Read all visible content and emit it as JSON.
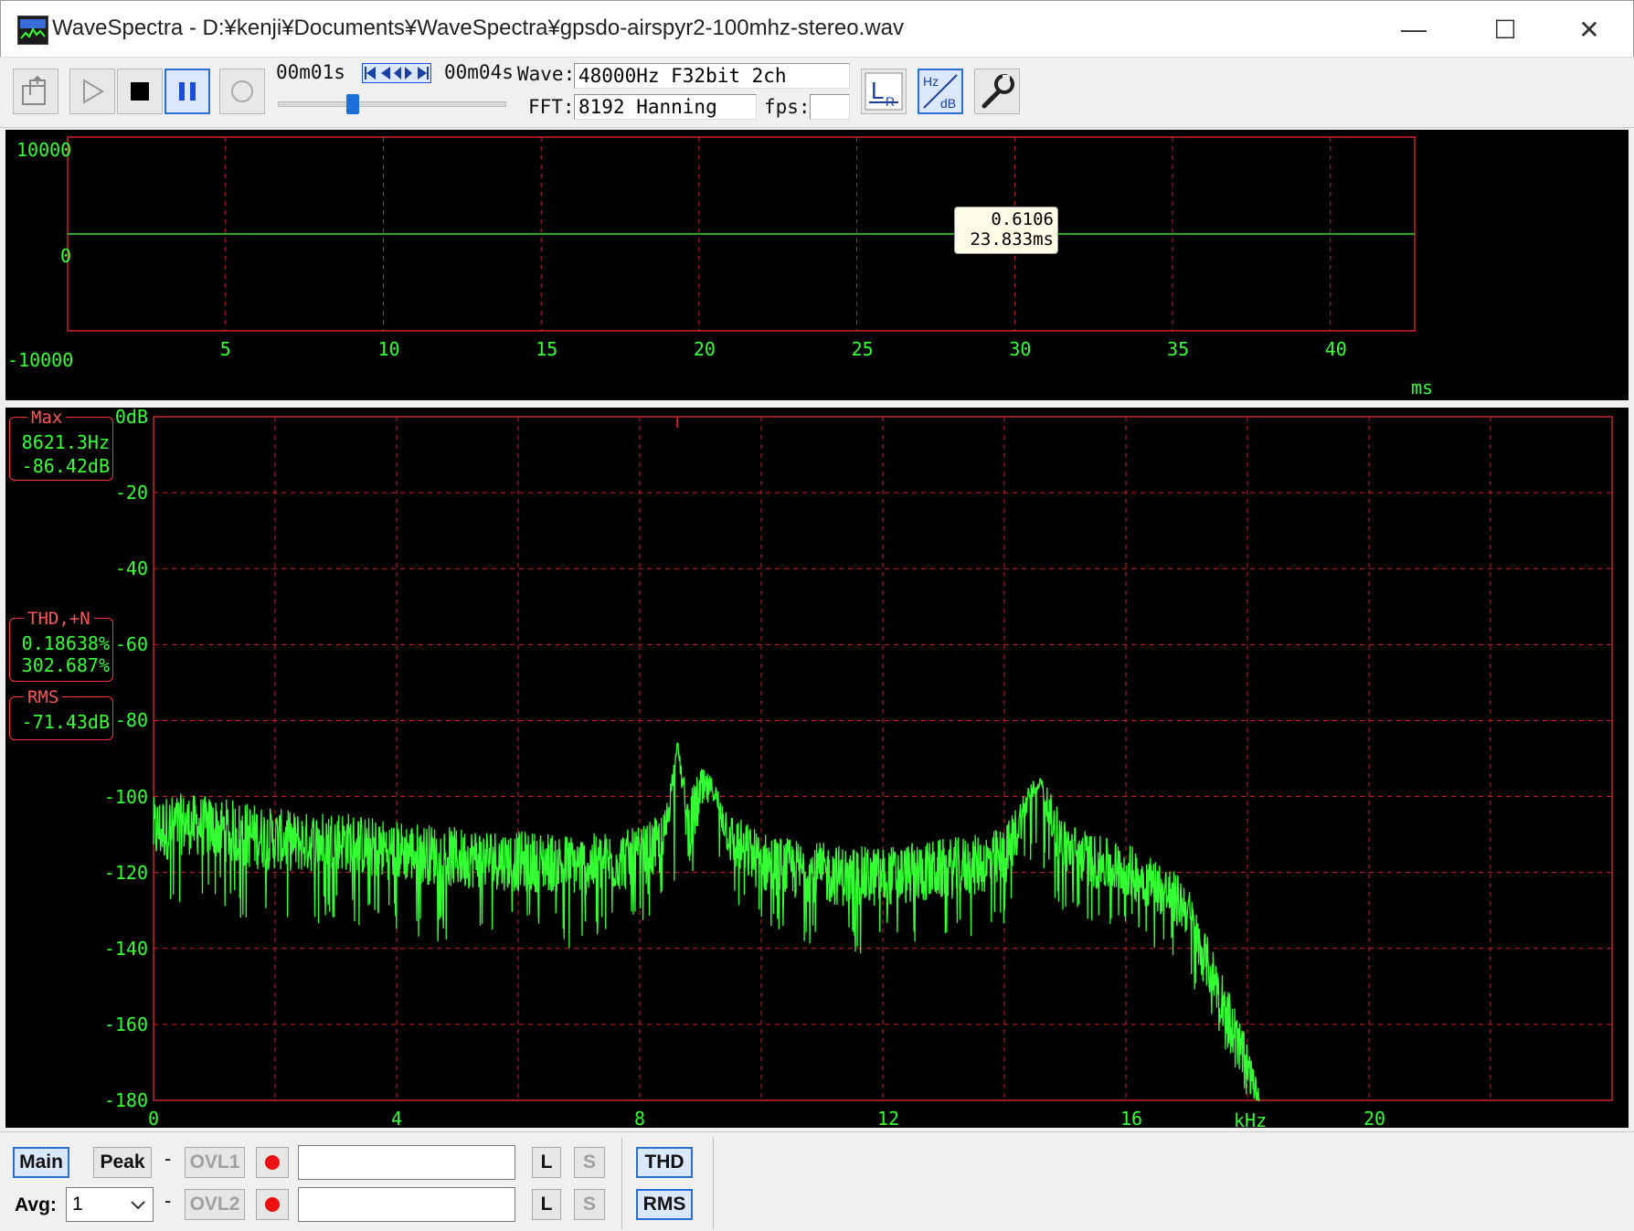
{
  "window": {
    "title": "WaveSpectra - D:¥kenji¥Documents¥WaveSpectra¥gpsdo-airspyr2-100mhz-stereo.wav",
    "minimize": "—",
    "maximize": "☐",
    "close": "✕"
  },
  "toolbar": {
    "time_start": "00m01s",
    "time_end": "00m04s",
    "wave_label": "Wave:",
    "wave_value": "48000Hz F32bit 2ch",
    "fft_label": "FFT:",
    "fft_value": "8192 Hanning",
    "fps_label": "fps:",
    "fps_value": "",
    "seek_position": 0.32
  },
  "wave_panel": {
    "tooltip_value": "0.6106",
    "tooltip_time": "23.833ms",
    "unit": "ms"
  },
  "spectrum_panel": {
    "max_title": "Max",
    "max_freq": "8621.3Hz",
    "max_db": "-86.42dB",
    "thd_title": "THD,+N",
    "thd_value": "0.18638%",
    "thdn_value": "302.687%",
    "rms_title": "RMS",
    "rms_value": "-71.43dB",
    "unit": "kHz"
  },
  "chart_data": [
    {
      "type": "line",
      "x_ticks": [
        "5",
        "10",
        "15",
        "20",
        "25",
        "30",
        "35",
        "40"
      ],
      "y_ticks": [
        "10000",
        "0",
        "-10000"
      ],
      "xlim": [
        0,
        42.67
      ],
      "ylim": [
        -10000,
        10000
      ],
      "series": [
        {
          "x": [
            0,
            42.67
          ],
          "y": [
            0,
            0
          ]
        }
      ],
      "grid": true,
      "line_color": "#33dd33",
      "grid_color": "#cc2222"
    },
    {
      "type": "area",
      "x_ticks": [
        "0",
        "4",
        "8",
        "12",
        "16",
        "20"
      ],
      "y_ticks": [
        "0dB",
        "-20",
        "-40",
        "-60",
        "-80",
        "-100",
        "-120",
        "-140",
        "-160",
        "-180"
      ],
      "xlim": [
        0,
        24
      ],
      "ylim": [
        -180,
        0
      ],
      "grid": true,
      "line_color": "#33ff33",
      "grid_color": "#cc2222",
      "series": [
        {
          "x": [
            0,
            0.5,
            1,
            1.5,
            2,
            2.5,
            3,
            3.5,
            4,
            4.5,
            5,
            5.5,
            6,
            6.5,
            7,
            7.5,
            8,
            8.4,
            8.62,
            8.8,
            9.0,
            9.2,
            9.5,
            10,
            10.5,
            11,
            11.5,
            12,
            12.5,
            13,
            13.5,
            14,
            14.2,
            14.4,
            14.6,
            14.8,
            15,
            15.5,
            16,
            16.5,
            17,
            17.2,
            17.5,
            17.8,
            18,
            18.2
          ],
          "y": [
            -110,
            -108,
            -109,
            -111,
            -112,
            -113,
            -112,
            -114,
            -115,
            -116,
            -117,
            -117,
            -118,
            -118,
            -119,
            -118,
            -117,
            -113,
            -86,
            -110,
            -100,
            -98,
            -112,
            -118,
            -120,
            -121,
            -122,
            -122,
            -121,
            -120,
            -119,
            -117,
            -110,
            -100,
            -96,
            -108,
            -114,
            -118,
            -120,
            -124,
            -130,
            -140,
            -150,
            -163,
            -172,
            -180
          ],
          "min": [
            -135,
            -130,
            -128,
            -134,
            -132,
            -138,
            -132,
            -135,
            -136,
            -138,
            -140,
            -135,
            -136,
            -138,
            -142,
            -135,
            -133,
            -130,
            -120,
            -128,
            -120,
            -118,
            -130,
            -135,
            -138,
            -140,
            -142,
            -140,
            -141,
            -138,
            -137,
            -134,
            -126,
            -120,
            -118,
            -126,
            -132,
            -134,
            -136,
            -140,
            -146,
            -154,
            -162,
            -172,
            -180,
            -180
          ],
          "max": [
            -100,
            -99,
            -100,
            -101,
            -103,
            -104,
            -103,
            -105,
            -106,
            -107,
            -108,
            -108,
            -109,
            -109,
            -110,
            -109,
            -108,
            -104,
            -86,
            -100,
            -92,
            -95,
            -104,
            -109,
            -111,
            -112,
            -113,
            -113,
            -112,
            -111,
            -110,
            -108,
            -102,
            -96,
            -95,
            -100,
            -106,
            -110,
            -112,
            -116,
            -122,
            -132,
            -142,
            -155,
            -165,
            -178
          ]
        }
      ]
    }
  ],
  "bottom": {
    "main": "Main",
    "peak": "Peak",
    "ovl1": "OVL1",
    "ovl2": "OVL2",
    "l": "L",
    "s": "S",
    "thd": "THD",
    "rms": "RMS",
    "avg_label": "Avg:",
    "avg_value": "1",
    "dash": "-"
  }
}
